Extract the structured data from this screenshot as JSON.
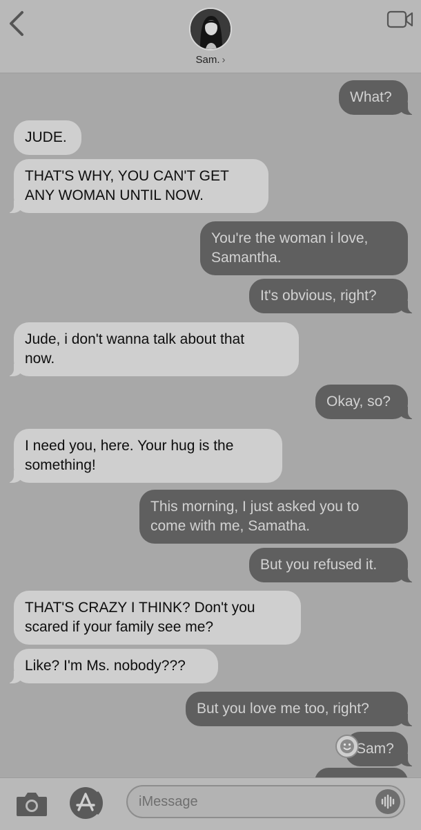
{
  "header": {
    "contact_name": "Sam.",
    "chevron": "›",
    "icons": {
      "back": "back-chevron-icon",
      "video": "video-camera-icon",
      "avatar": "contact-avatar"
    }
  },
  "messages": [
    {
      "dir": "out",
      "text": "What?"
    },
    {
      "dir": "in",
      "text": "JUDE."
    },
    {
      "dir": "in",
      "text": "THAT'S WHY, YOU CAN'T GET\nANY WOMAN UNTIL NOW."
    },
    {
      "dir": "out",
      "text": "You're the woman i love,\nSamantha."
    },
    {
      "dir": "out",
      "text": "It's obvious, right?"
    },
    {
      "dir": "in",
      "text": "Jude, i don't wanna talk about that\nnow."
    },
    {
      "dir": "out",
      "text": "Okay, so?"
    },
    {
      "dir": "in",
      "text": "I need you, here. Your hug is the\nsomething!"
    },
    {
      "dir": "out",
      "text": "This morning, I just asked you to\ncome with me, Samatha."
    },
    {
      "dir": "out",
      "text": "But you refused it."
    },
    {
      "dir": "in",
      "text": "THAT'S CRAZY I THINK? Don't you\nscared if your family see me?"
    },
    {
      "dir": "in",
      "text": "Like? I'm Ms. nobody???"
    },
    {
      "dir": "out",
      "text": "But you love me too, right?"
    },
    {
      "dir": "out",
      "text": "Sam?"
    }
  ],
  "composer": {
    "placeholder": "iMessage",
    "icons": {
      "camera": "camera-icon",
      "apps": "app-store-icon",
      "audio": "audio-waveform-icon",
      "sticker": "sticker-icon"
    }
  },
  "colors": {
    "background": "#a8a8a8",
    "incoming_bubble": "#cfcfcf",
    "outgoing_bubble": "#5f5f5f",
    "bar": "#b9b9b9"
  }
}
